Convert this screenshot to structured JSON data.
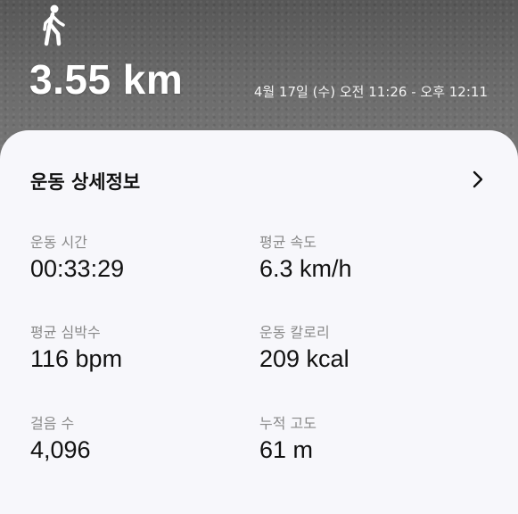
{
  "header": {
    "activity_icon": "walking-person-icon",
    "distance": "3.55 km",
    "datetime": "4월 17일 (수) 오전 11:26 - 오후 12:11"
  },
  "details": {
    "title": "운동 상세정보",
    "chevron_icon": "chevron-right-icon",
    "stats": [
      {
        "label": "운동 시간",
        "value": "00:33:29"
      },
      {
        "label": "평균 속도",
        "value": "6.3 km/h"
      },
      {
        "label": "평균 심박수",
        "value": "116 bpm"
      },
      {
        "label": "운동 칼로리",
        "value": "209 kcal"
      },
      {
        "label": "걸음 수",
        "value": "4,096"
      },
      {
        "label": "누적 고도",
        "value": "61 m"
      }
    ]
  },
  "colors": {
    "card_bg": "#f7f7fb",
    "label": "#8a8a8a",
    "value": "#111111",
    "hero_text": "#ffffff"
  }
}
